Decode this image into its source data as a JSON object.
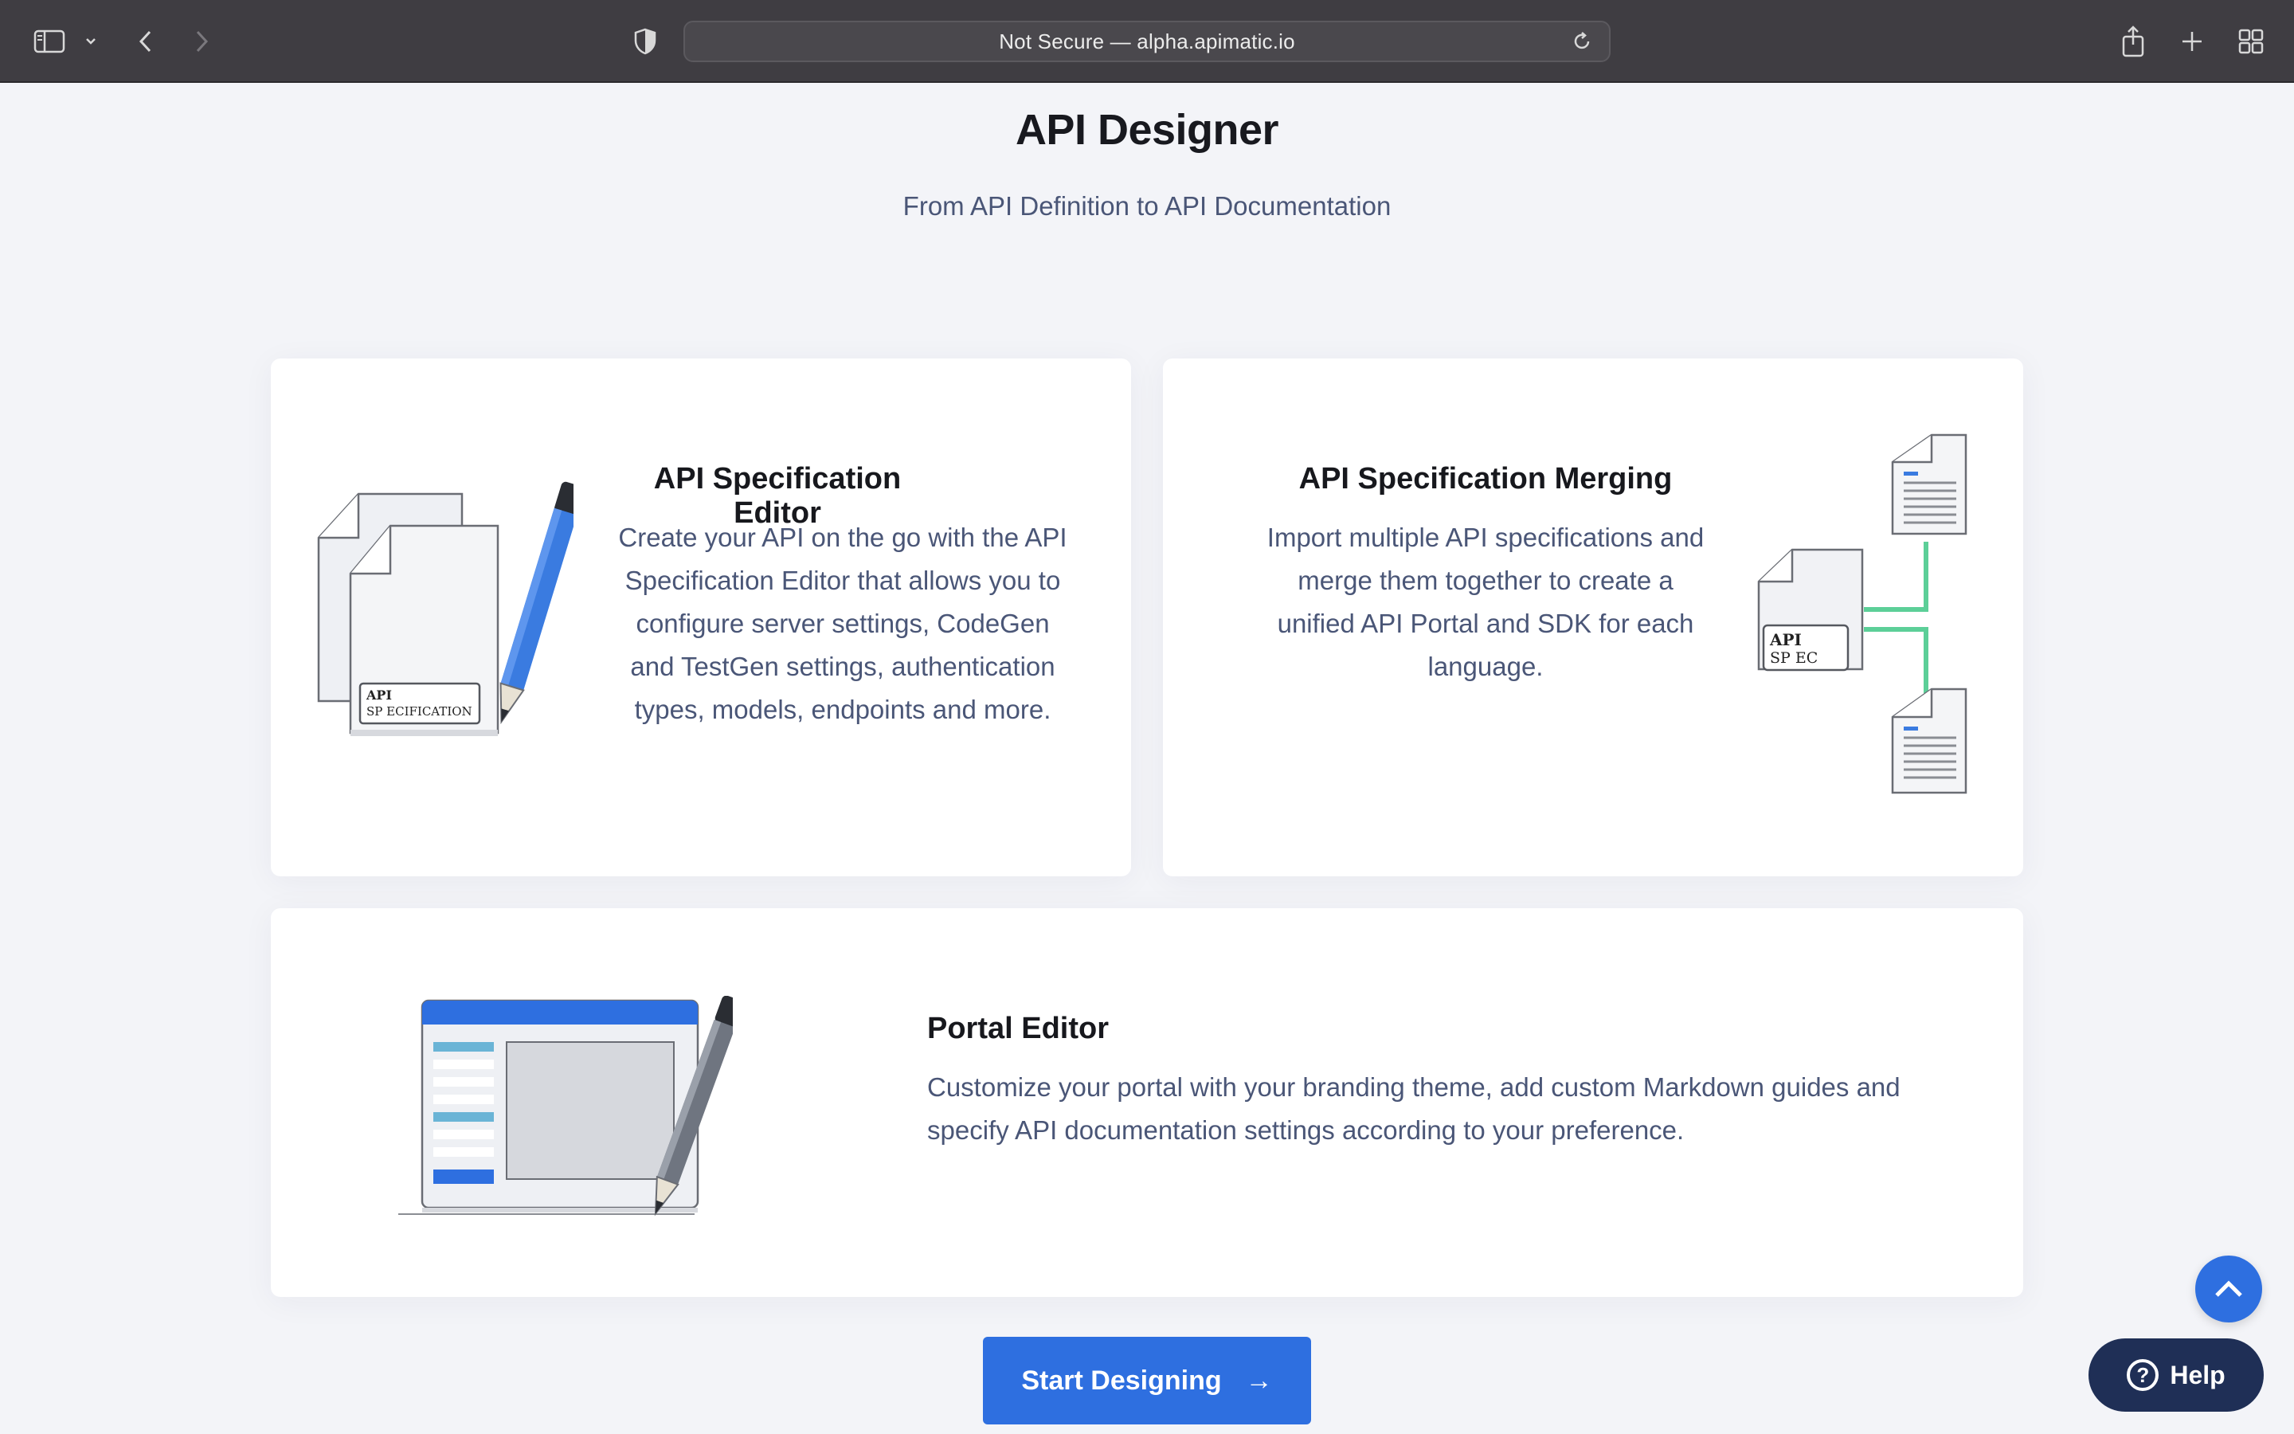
{
  "browser": {
    "url_text": "Not Secure — alpha.apimatic.io"
  },
  "page": {
    "title": "API Designer",
    "subtitle": "From API Definition to API Documentation"
  },
  "cards": [
    {
      "title": "API Specification Editor",
      "description": "Create your API on the go with the API Specification Editor that allows you to configure server settings, CodeGen and TestGen settings, authentication types, models, endpoints and more.",
      "illustration_label_line1": "API",
      "illustration_label_line2": "SP ECIFICATION"
    },
    {
      "title": "API Specification Merging",
      "description": "Import multiple API specifications and merge them together to create a unified API Portal and SDK for each language.",
      "illustration_label_line1": "API",
      "illustration_label_line2": "SP EC"
    },
    {
      "title": "Portal Editor",
      "description": "Customize your portal with your branding theme, add custom Markdown guides and specify API documentation settings according to your preference."
    }
  ],
  "cta": {
    "label": "Start Designing",
    "arrow": "→"
  },
  "help": {
    "icon_glyph": "?",
    "label": "Help"
  },
  "colors": {
    "accent": "#2e6fe0",
    "help_bg": "#1f2f56",
    "page_bg": "#f3f4f8",
    "connector": "#5ccf98"
  }
}
